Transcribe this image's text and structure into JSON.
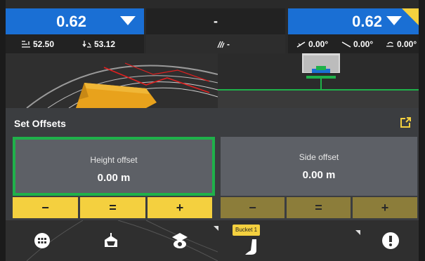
{
  "header": {
    "left_value": "0.62",
    "left_sub_1": "52.50",
    "left_sub_2": "53.12",
    "mid_value": "-",
    "mid_sub": "-",
    "right_value": "0.62",
    "right_sub_1": "0.00°",
    "right_sub_2": "0.00°",
    "right_sub_3": "0.00°"
  },
  "panel": {
    "title": "Set Offsets",
    "height_offset": {
      "label": "Height offset",
      "value": "0.00 m"
    },
    "side_offset": {
      "label": "Side offset",
      "value": "0.00 m"
    },
    "buttons": {
      "minus": "−",
      "equals": "=",
      "plus": "+"
    }
  },
  "toolbar": {
    "bucket_label": "Bucket 1"
  },
  "colors": {
    "accent_blue": "#1a6fd4",
    "accent_yellow": "#f4d03f",
    "selection_green": "#1fb14a",
    "design_red": "#e02020"
  },
  "icons": [
    "menu-grid-icon",
    "machine-view-icon",
    "target-view-icon",
    "bucket-icon",
    "warning-icon",
    "popout-icon",
    "elevation-icon",
    "slope-icon"
  ]
}
